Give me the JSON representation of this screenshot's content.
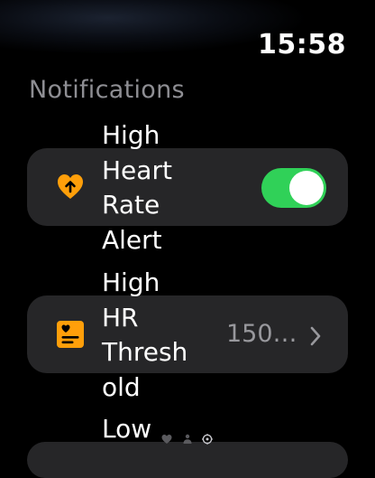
{
  "status_bar": {
    "time": "15:58"
  },
  "section": {
    "title": "Notifications"
  },
  "rows": [
    {
      "label": "High\nHeart\nRate\nAlert",
      "icon": "heart-arrow-up-icon",
      "control": "toggle",
      "toggle_on": true
    },
    {
      "label": "High\nHR\nThresh\nold",
      "icon": "heart-card-icon",
      "control": "value",
      "value": "150…"
    },
    {
      "label": "Low",
      "icon": "",
      "control": "none"
    }
  ],
  "colors": {
    "accent_orange": "#ff9f0a",
    "toggle_green": "#30d158",
    "card_bg": "#262628",
    "secondary_text": "#8e8e93"
  },
  "page_indicator_icons": [
    "heart-icon",
    "person-icon",
    "gear-icon"
  ]
}
